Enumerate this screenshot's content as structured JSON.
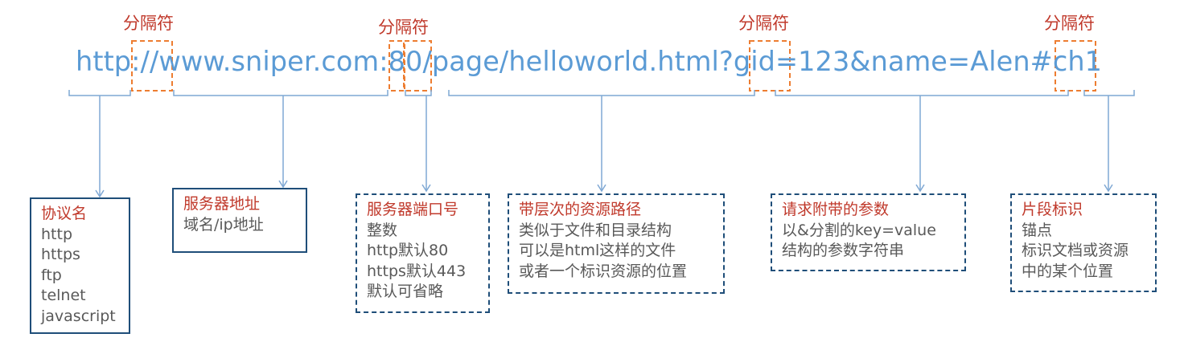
{
  "url": "http://www.sniper.com:80/page/helloworld.html?gid=123&name=Alen#ch1",
  "separators": [
    {
      "label": "分隔符"
    },
    {
      "label": "分隔符"
    },
    {
      "label": "分隔符"
    },
    {
      "label": "分隔符"
    }
  ],
  "components": [
    {
      "title": "协议名",
      "lines": [
        "http",
        "https",
        "ftp",
        "telnet",
        "javascript"
      ]
    },
    {
      "title": "服务器地址",
      "lines": [
        "域名/ip地址"
      ]
    },
    {
      "title": "服务器端口号",
      "lines": [
        "整数",
        "http默认80",
        "https默认443",
        "默认可省略"
      ]
    },
    {
      "title": "带层次的资源路径",
      "lines": [
        "类似于文件和目录结构",
        "可以是html这样的文件",
        "或者一个标识资源的位置"
      ]
    },
    {
      "title": "请求附带的参数",
      "lines": [
        "以&分割的key=value",
        "结构的参数字符串"
      ]
    },
    {
      "title": "片段标识",
      "lines": [
        "锚点",
        "标识文档或资源",
        "中的某个位置"
      ]
    }
  ],
  "colors": {
    "url_text": "#5b9bd5",
    "separator": "#ed7d31",
    "label_red": "#c0392b",
    "box_border": "#1f4e79",
    "body_text": "#595959",
    "connector": "#7fa8d4"
  }
}
